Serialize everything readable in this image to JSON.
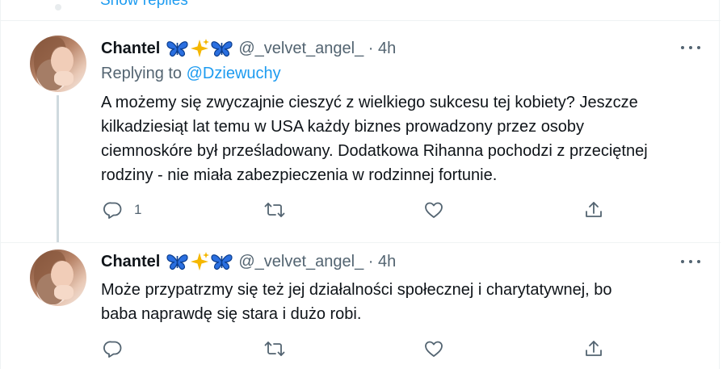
{
  "top": {
    "show_replies_label": "Show replies"
  },
  "tweets": [
    {
      "display_name": "Chantel",
      "emojis": [
        "butterfly-icon",
        "sparkles-icon",
        "butterfly-icon"
      ],
      "handle_time": "@_velvet_angel_ · 4h",
      "replying_prefix": "Replying to ",
      "replying_mention": "@Dziewuchy",
      "text_lines": [
        "A możemy się zwyczajnie cieszyć z wielkiego sukcesu tej kobiety? Jeszcze",
        "kilkadziesiąt lat temu w USA każdy biznes prowadzony przez osoby",
        "ciemnoskóre był prześladowany. Dodatkowa Rihanna pochodzi z przeciętnej",
        "rodziny - nie miała zabezpieczenia w rodzinnej fortunie."
      ],
      "reply_count": "1",
      "retweet_count": "",
      "like_count": ""
    },
    {
      "display_name": "Chantel",
      "emojis": [
        "butterfly-icon",
        "sparkles-icon",
        "butterfly-icon"
      ],
      "handle_time": "@_velvet_angel_ · 4h",
      "text_lines": [
        "Może przypatrzmy się też jej działalności społecznej i charytatywnej, bo",
        "baba naprawdę się stara i dużo robi."
      ],
      "reply_count": "",
      "retweet_count": "",
      "like_count": ""
    }
  ],
  "colors": {
    "accent": "#1d9bf0",
    "text_primary": "#0f1419",
    "text_secondary": "#536471",
    "thread_line": "#cfd9de",
    "divider": "#eff3f4",
    "butterfly": "#2a6fe0",
    "sparkles": "#f5b700"
  }
}
